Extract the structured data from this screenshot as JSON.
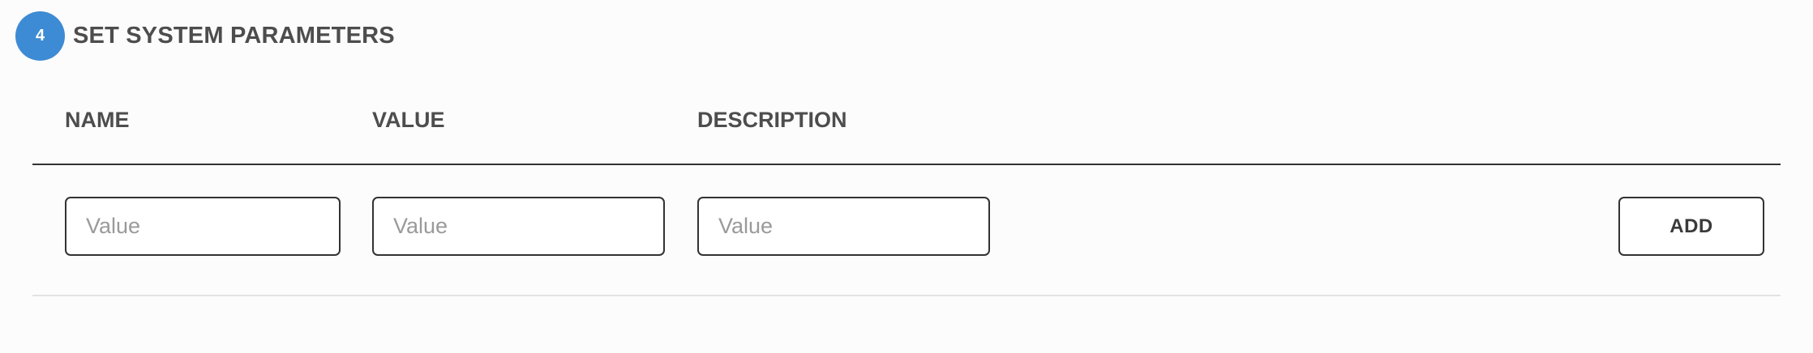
{
  "section": {
    "step_number": "4",
    "title": "SET SYSTEM PARAMETERS"
  },
  "table": {
    "columns": [
      "NAME",
      "VALUE",
      "DESCRIPTION"
    ]
  },
  "form": {
    "name_placeholder": "Value",
    "value_placeholder": "Value",
    "description_placeholder": "Value",
    "name_value": "",
    "value_value": "",
    "description_value": "",
    "add_label": "ADD"
  },
  "colors": {
    "badge": "#3d8bd4",
    "text": "#4d4d4d",
    "border": "#333333",
    "divider": "#e3e3e3"
  }
}
